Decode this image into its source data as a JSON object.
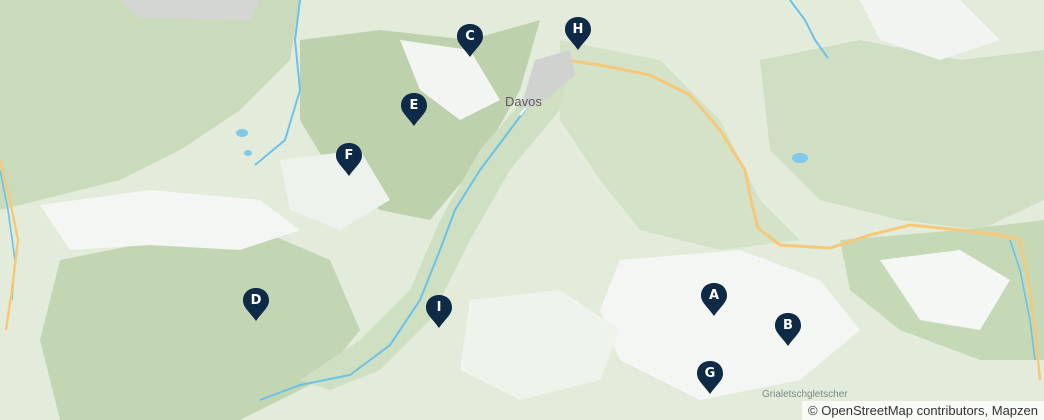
{
  "map": {
    "place_labels": {
      "town": "Davos",
      "glacier": "Grialetschgletscher"
    },
    "markers": [
      {
        "label": "A"
      },
      {
        "label": "B"
      },
      {
        "label": "C"
      },
      {
        "label": "D"
      },
      {
        "label": "E"
      },
      {
        "label": "F"
      },
      {
        "label": "G"
      },
      {
        "label": "H"
      },
      {
        "label": "I"
      }
    ],
    "attribution": "© OpenStreetMap contributors, Mapzen",
    "colors": {
      "marker": "#0f2a47",
      "road": "#f6c879",
      "river": "#6cc1e8",
      "forest": "#b9cfa9",
      "meadow": "#e4eedd",
      "snow": "#f6f8f7"
    }
  }
}
